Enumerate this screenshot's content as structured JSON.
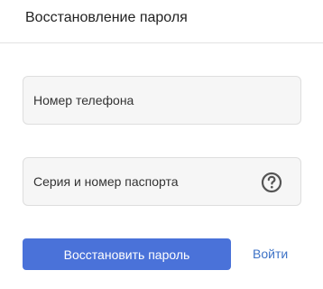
{
  "header": {
    "title": "Восстановление пароля"
  },
  "form": {
    "phone": {
      "placeholder": "Номер телефона",
      "value": ""
    },
    "passport": {
      "placeholder": "Серия и номер паспорта",
      "value": "",
      "help_icon": "question-circle-icon"
    },
    "submit_label": "Восстановить пароль",
    "login_link_label": "Войти"
  },
  "colors": {
    "primary_button": "#4a72d9",
    "link": "#3d72c6",
    "field_background": "#f6f6f6",
    "field_border": "#dedede",
    "divider": "#e3e3e3",
    "icon": "#555555"
  }
}
